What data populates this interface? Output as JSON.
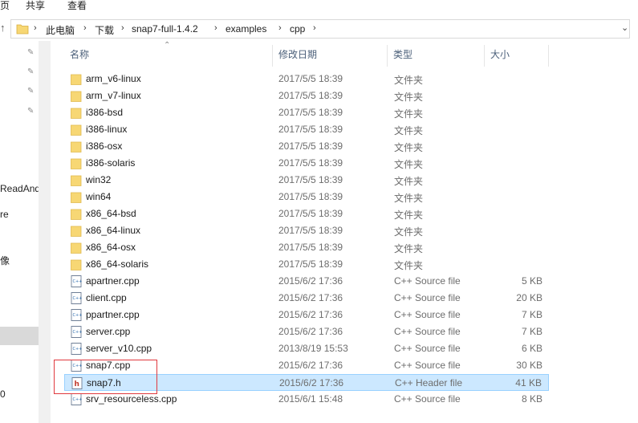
{
  "ribbon": {
    "tab_left": "页",
    "tab_share": "共享",
    "tab_view": "查看"
  },
  "address": {
    "crumbs": [
      "此电脑",
      "下载",
      "snap7-full-1.4.2",
      "examples",
      "cpp"
    ]
  },
  "nav": {
    "items": [
      "ReadAnd",
      "re",
      "像",
      "0"
    ]
  },
  "columns": {
    "name": "名称",
    "date": "修改日期",
    "type": "类型",
    "size": "大小"
  },
  "rows": [
    {
      "name": "arm_v6-linux",
      "date": "2017/5/5 18:39",
      "type": "文件夹",
      "size": "",
      "icon": "folder-icon"
    },
    {
      "name": "arm_v7-linux",
      "date": "2017/5/5 18:39",
      "type": "文件夹",
      "size": "",
      "icon": "folder-icon"
    },
    {
      "name": "i386-bsd",
      "date": "2017/5/5 18:39",
      "type": "文件夹",
      "size": "",
      "icon": "folder-icon"
    },
    {
      "name": "i386-linux",
      "date": "2017/5/5 18:39",
      "type": "文件夹",
      "size": "",
      "icon": "folder-icon"
    },
    {
      "name": "i386-osx",
      "date": "2017/5/5 18:39",
      "type": "文件夹",
      "size": "",
      "icon": "folder-icon"
    },
    {
      "name": "i386-solaris",
      "date": "2017/5/5 18:39",
      "type": "文件夹",
      "size": "",
      "icon": "folder-icon"
    },
    {
      "name": "win32",
      "date": "2017/5/5 18:39",
      "type": "文件夹",
      "size": "",
      "icon": "folder-icon"
    },
    {
      "name": "win64",
      "date": "2017/5/5 18:39",
      "type": "文件夹",
      "size": "",
      "icon": "folder-icon"
    },
    {
      "name": "x86_64-bsd",
      "date": "2017/5/5 18:39",
      "type": "文件夹",
      "size": "",
      "icon": "folder-icon"
    },
    {
      "name": "x86_64-linux",
      "date": "2017/5/5 18:39",
      "type": "文件夹",
      "size": "",
      "icon": "folder-icon"
    },
    {
      "name": "x86_64-osx",
      "date": "2017/5/5 18:39",
      "type": "文件夹",
      "size": "",
      "icon": "folder-icon"
    },
    {
      "name": "x86_64-solaris",
      "date": "2017/5/5 18:39",
      "type": "文件夹",
      "size": "",
      "icon": "folder-icon"
    },
    {
      "name": "apartner.cpp",
      "date": "2015/6/2 17:36",
      "type": "C++ Source file",
      "size": "5 KB",
      "icon": "cpp-file-icon"
    },
    {
      "name": "client.cpp",
      "date": "2015/6/2 17:36",
      "type": "C++ Source file",
      "size": "20 KB",
      "icon": "cpp-file-icon"
    },
    {
      "name": "ppartner.cpp",
      "date": "2015/6/2 17:36",
      "type": "C++ Source file",
      "size": "7 KB",
      "icon": "cpp-file-icon"
    },
    {
      "name": "server.cpp",
      "date": "2015/6/2 17:36",
      "type": "C++ Source file",
      "size": "7 KB",
      "icon": "cpp-file-icon"
    },
    {
      "name": "server_v10.cpp",
      "date": "2013/8/19 15:53",
      "type": "C++ Source file",
      "size": "6 KB",
      "icon": "cpp-file-icon"
    },
    {
      "name": "snap7.cpp",
      "date": "2015/6/2 17:36",
      "type": "C++ Source file",
      "size": "30 KB",
      "icon": "cpp-file-icon"
    },
    {
      "name": "snap7.h",
      "date": "2015/6/2 17:36",
      "type": "C++ Header file",
      "size": "41 KB",
      "icon": "header-file-icon",
      "selected": true
    },
    {
      "name": "srv_resourceless.cpp",
      "date": "2015/6/1 15:48",
      "type": "C++ Source file",
      "size": "8 KB",
      "icon": "cpp-file-icon"
    }
  ],
  "colors": {
    "selection": "#cce8ff",
    "folder": "#f7d774",
    "highlight_box": "#e0393e"
  }
}
